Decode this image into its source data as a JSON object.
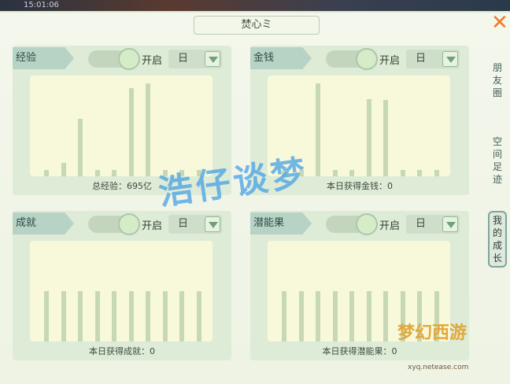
{
  "topbar": {
    "time": "15:01:06"
  },
  "window": {
    "title": "焚心ミ",
    "close": "✕"
  },
  "panels": [
    {
      "label": "经验",
      "toggle": "开启",
      "period": "日",
      "caption": "总经验：695亿",
      "values": [
        8,
        17,
        73,
        8,
        8,
        112,
        118,
        8,
        8,
        8
      ]
    },
    {
      "label": "金钱",
      "toggle": "开启",
      "period": "日",
      "caption": "本日获得金钱：0",
      "values": [
        8,
        8,
        118,
        8,
        8,
        98,
        97,
        8,
        8,
        8
      ]
    },
    {
      "label": "成就",
      "toggle": "开启",
      "period": "日",
      "caption": "本日获得成就：0",
      "values": [
        64,
        64,
        64,
        64,
        64,
        64,
        64,
        64,
        64,
        64
      ]
    },
    {
      "label": "潜能果",
      "toggle": "开启",
      "period": "日",
      "caption": "本日获得潜能果：0",
      "values": [
        64,
        64,
        64,
        64,
        64,
        64,
        64,
        64,
        64,
        64
      ]
    }
  ],
  "side_tabs": [
    "朋友圈",
    "空间足迹",
    "我的成长"
  ],
  "watermark": "浩仔谈梦",
  "logo": {
    "text": "梦幻西游",
    "sub": "xyq.netease.com"
  }
}
